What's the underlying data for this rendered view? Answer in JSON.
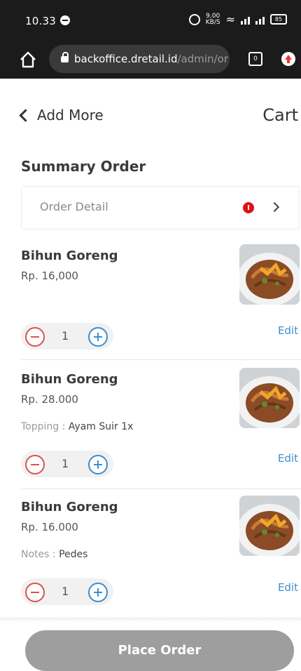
{
  "status_bar": {
    "time": "10.33",
    "speed": "9,00\nKB/S",
    "battery": "85"
  },
  "browser": {
    "url_main": "backoffice.dretail.id",
    "url_path": "/admin/or",
    "tab_count": "0"
  },
  "header": {
    "back_label": "Add More",
    "title": "Cart"
  },
  "summary": {
    "title": "Summary Order",
    "order_detail_label": "Order Detail"
  },
  "items": [
    {
      "name": "Bihun Goreng",
      "price": "Rp. 16,000",
      "note_label": "",
      "note_value": "",
      "quantity": "1",
      "edit_label": "Edit"
    },
    {
      "name": "Bihun Goreng",
      "price": "Rp. 28.000",
      "note_label": "Topping : ",
      "note_value": "Ayam Suir 1x",
      "quantity": "1",
      "edit_label": "Edit"
    },
    {
      "name": "Bihun Goreng",
      "price": "Rp. 16.000",
      "note_label": "Notes : ",
      "note_value": "Pedes",
      "quantity": "1",
      "edit_label": "Edit"
    }
  ],
  "footer": {
    "place_order_label": "Place Order"
  },
  "colors": {
    "accent_blue": "#3a8fd1",
    "minus_red": "#d9534f",
    "alert_red": "#e0101a",
    "button_gray": "#9e9e9e"
  }
}
